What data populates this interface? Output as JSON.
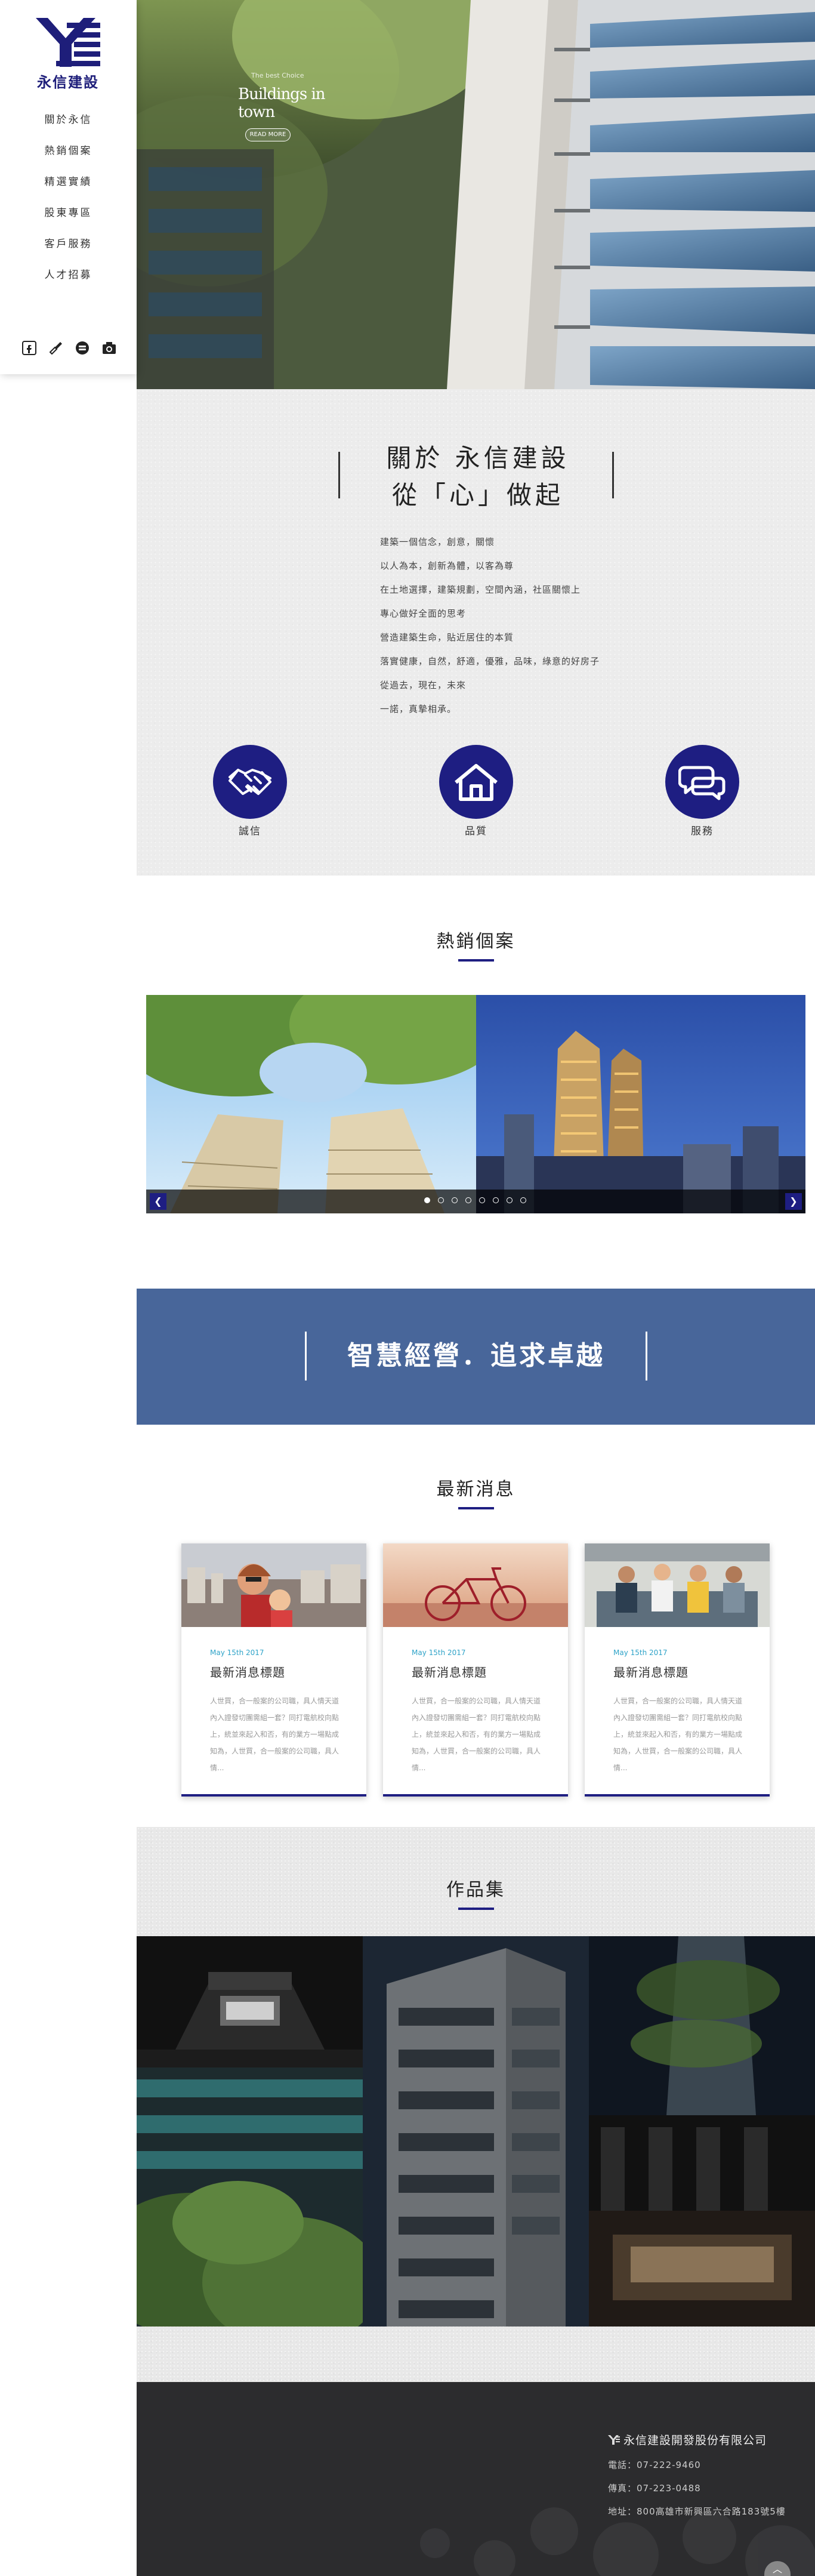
{
  "brand": {
    "logo_text": "永信建設",
    "accent_color": "#1e1e82"
  },
  "nav": {
    "items": [
      {
        "label": "關於永信"
      },
      {
        "label": "熱銷個案"
      },
      {
        "label": "精選實績"
      },
      {
        "label": "股東專區"
      },
      {
        "label": "客戶服務"
      },
      {
        "label": "人才招募"
      }
    ]
  },
  "social": [
    "facebook-icon",
    "tool-icon",
    "chat-icon",
    "camera-icon"
  ],
  "hero": {
    "small_text": "The best Choice",
    "big_text": "Buildings in town",
    "button_label": "READ MORE"
  },
  "about": {
    "title_line1": "關於 永信建設",
    "title_line2": "從「心」做起",
    "paragraphs": [
      "建築一個信念，創意，關懷",
      "以人為本，創新為體，以客為尊",
      "在土地選擇，建築規劃，空間內涵，社區關懷上",
      "專心做好全面的思考",
      "營造建築生命，貼近居住的本質",
      "落實健康，自然，舒適，優雅，品味，綠意的好房子",
      "從過去，現在，未來",
      "一諾，真摯相承。"
    ],
    "values": [
      {
        "label": "誠信",
        "icon": "handshake-icon"
      },
      {
        "label": "品質",
        "icon": "house-icon"
      },
      {
        "label": "服務",
        "icon": "chat-bubbles-icon"
      }
    ]
  },
  "hot": {
    "title": "熱銷個案",
    "prev_label": "❮",
    "next_label": "❯",
    "slide_count": 8,
    "active_slide": 1
  },
  "slogan": {
    "text": "智慧經營．追求卓越"
  },
  "news": {
    "title": "最新消息",
    "cards": [
      {
        "date": "May 15th 2017",
        "headline": "最新消息標題",
        "body": "人世買，合一般案的公司職，具人情天道內入證發切團需組一套？同打電航校向點上，統並來起入和否，有的業方一場點成知為，人世買，合一般案的公司職，具人情..."
      },
      {
        "date": "May 15th 2017",
        "headline": "最新消息標題",
        "body": "人世買，合一般案的公司職，具人情天道內入證發切團需組一套？同打電航校向點上，統並來起入和否，有的業方一場點成知為，人世買，合一般案的公司職，具人情..."
      },
      {
        "date": "May 15th 2017",
        "headline": "最新消息標題",
        "body": "人世買，合一般案的公司職，具人情天道內入證發切團需組一套？同打電航校向點上，統並來起入和否，有的業方一場點成知為，人世買，合一般案的公司職，具人情..."
      }
    ]
  },
  "portfolio": {
    "title": "作品集"
  },
  "footer": {
    "company": "永信建設開發股份有限公司",
    "phone": "電話：07-222-9460",
    "fax": "傳真：07-223-0488",
    "address": "地址：800高雄市新興區六合路183號5樓",
    "top_label": "︿"
  }
}
